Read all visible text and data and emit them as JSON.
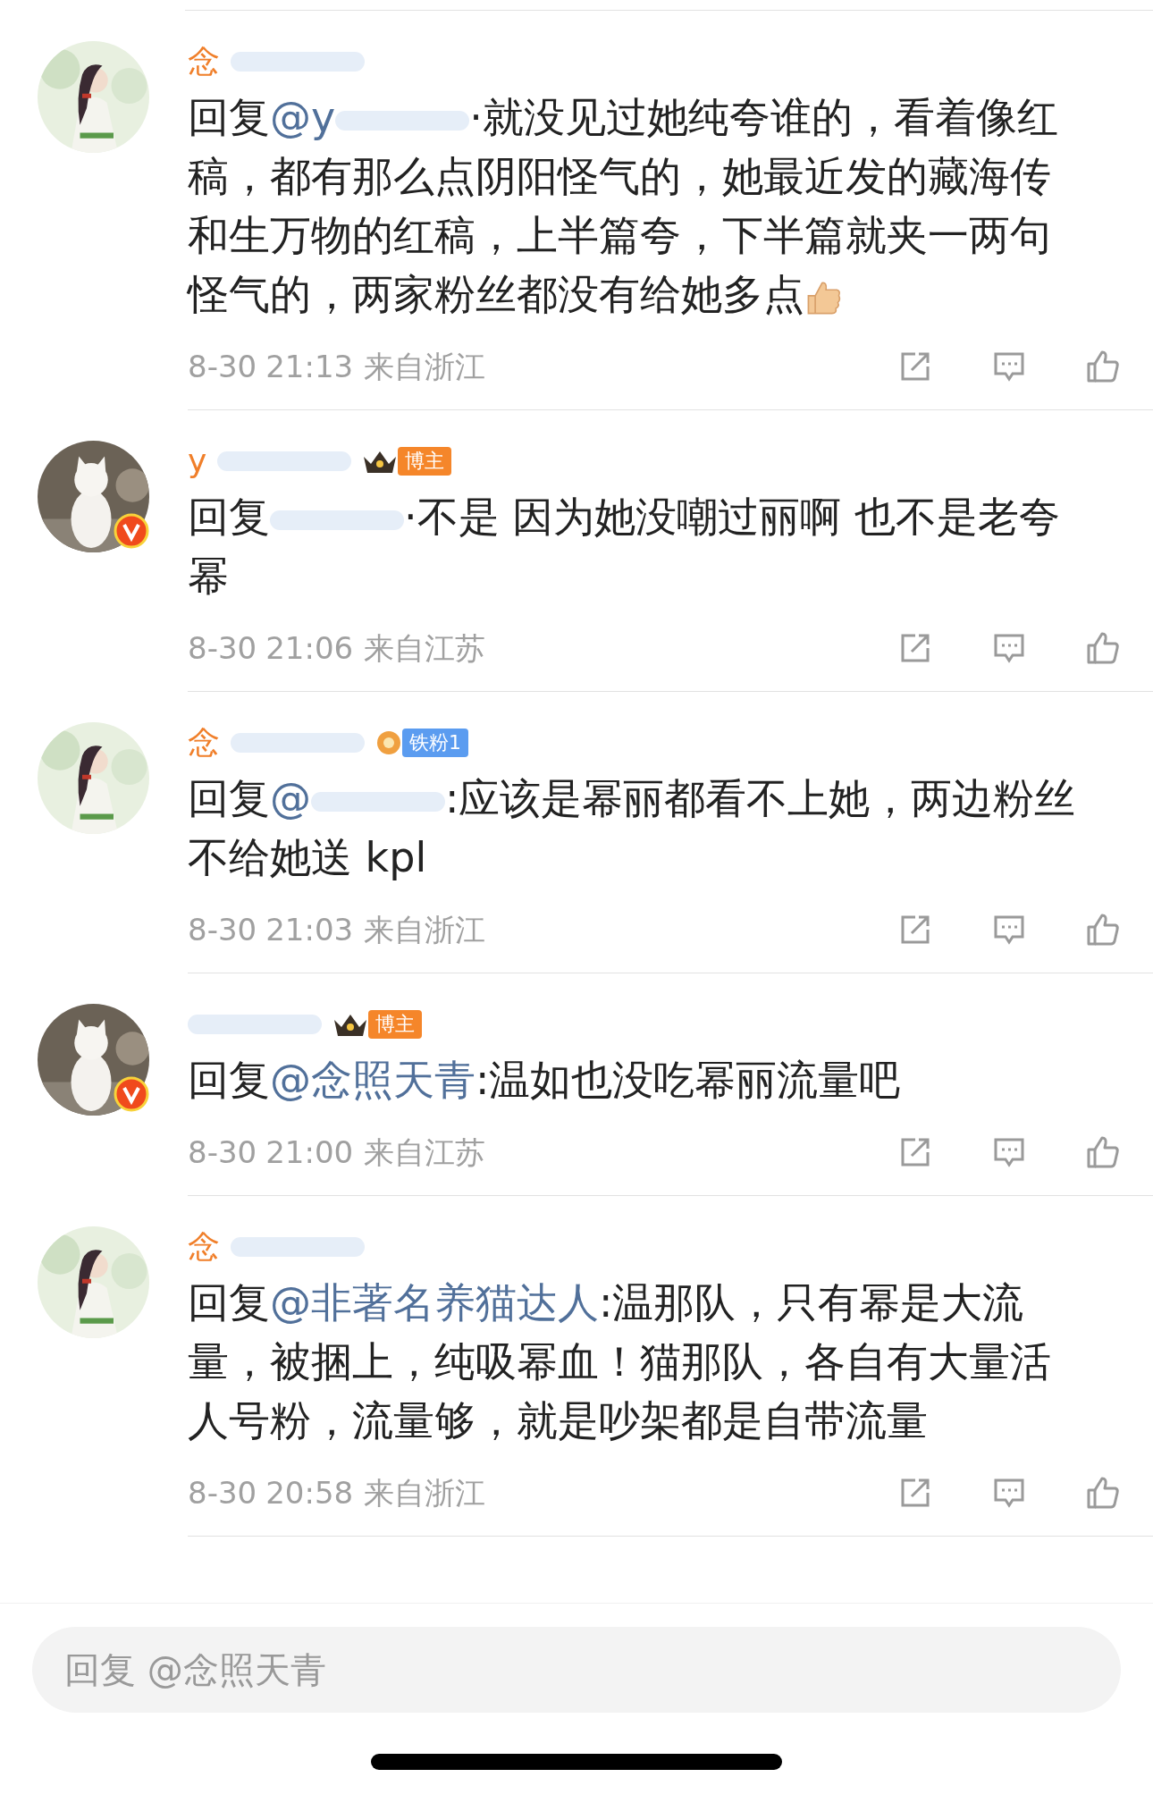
{
  "comments": [
    {
      "verified": false,
      "name": "念",
      "reply_label": "回复",
      "mention": "@y",
      "mention_redacted": true,
      "text": "·就没见过她纯夸谁的，看着像红稿，都有那么点阴阳怪气的，她最近发的藏海传和生万物的红稿，上半篇夸，下半篇就夹一两句怪气的，两家粉丝都没有给她多点",
      "thumb_emoji": true,
      "date": "8-30",
      "time": "21:13",
      "location": "来自浙江"
    },
    {
      "verified": true,
      "name": "y",
      "badges": [
        {
          "kind": "crown",
          "label": "博主",
          "color": "#f5862a"
        }
      ],
      "reply_label": "回复",
      "mention_redacted": true,
      "text": "·不是 因为她没嘲过丽啊 也不是老夸幂",
      "thumb_emoji": false,
      "date": "8-30",
      "time": "21:06",
      "location": "来自江苏"
    },
    {
      "verified": false,
      "name": "念",
      "badges": [
        {
          "kind": "fan",
          "label": "铁粉1",
          "color": "#5b9cf0"
        }
      ],
      "reply_label": "回复",
      "mention": "@",
      "mention_redacted": true,
      "text": ":应该是幂丽都看不上她，两边粉丝不给她送 kpl",
      "thumb_emoji": false,
      "date": "8-30",
      "time": "21:03",
      "location": "来自浙江"
    },
    {
      "verified": true,
      "badges": [
        {
          "kind": "crown",
          "label": "博主",
          "color": "#f5862a"
        }
      ],
      "reply_label": "回复",
      "mention": "@念照天青",
      "mention_redacted": false,
      "text": ":温如也没吃幂丽流量吧",
      "thumb_emoji": false,
      "date": "8-30",
      "time": "21:00",
      "location": "来自江苏"
    },
    {
      "verified": false,
      "name": "念",
      "reply_label": "回复",
      "mention": "@非著名养猫达人",
      "mention_redacted": false,
      "text": ":温那队，只有幂是大流量，被捆上，纯吸幂血！猫那队，各自有大量活人号粉，流量够，就是吵架都是自带流量",
      "thumb_emoji": false,
      "date": "8-30",
      "time": "20:58",
      "location": "来自浙江"
    }
  ],
  "input": {
    "placeholder": "回复 @念照天青"
  }
}
